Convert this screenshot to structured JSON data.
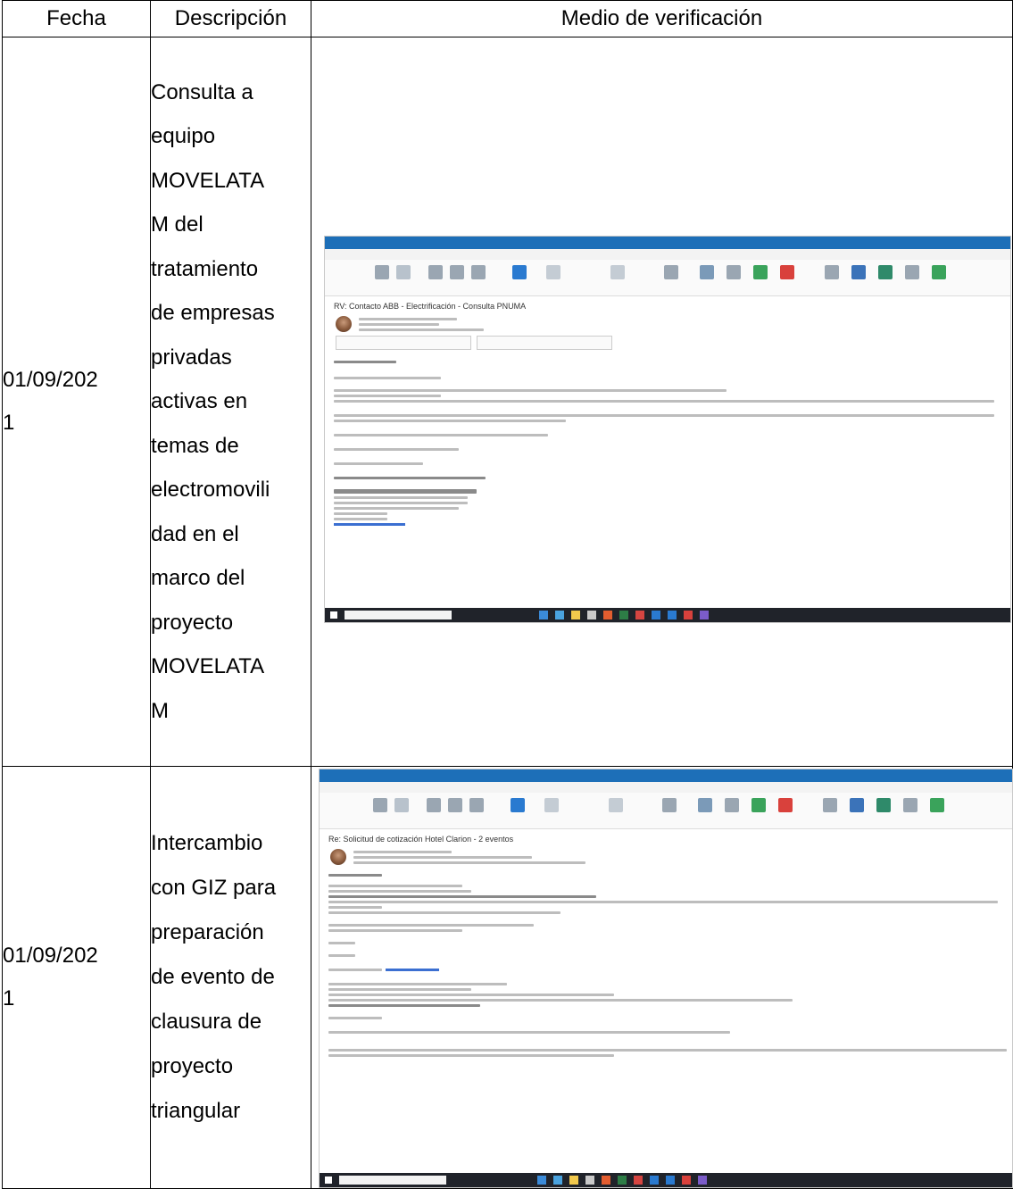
{
  "table": {
    "headers": {
      "date": "Fecha",
      "description": "Descripción",
      "verification": "Medio de verificación"
    },
    "rows": [
      {
        "date_line1": "01/09/202",
        "date_line2": "1",
        "description_lines": [
          "Consulta a",
          "equipo",
          "MOVELATA",
          "M del",
          "tratamiento",
          "de empresas",
          "privadas",
          "activas en",
          "temas de",
          "electromovili",
          "dad en el",
          "marco del",
          "proyecto",
          "MOVELATA",
          "M"
        ],
        "screenshot": {
          "subject": "RV: Contacto ABB - Electrificación - Consulta PNUMA"
        }
      },
      {
        "date_line1": "01/09/202",
        "date_line2": "1",
        "description_lines": [
          "Intercambio",
          "con GIZ para",
          "preparación",
          "de evento de",
          "clausura de",
          "proyecto",
          "triangular"
        ],
        "screenshot": {
          "subject": "Re: Solicitud de cotización Hotel Clarion - 2 eventos"
        }
      }
    ]
  },
  "colors": {
    "outlook_blue": "#1d6fb8",
    "taskbar": "#20232a"
  }
}
